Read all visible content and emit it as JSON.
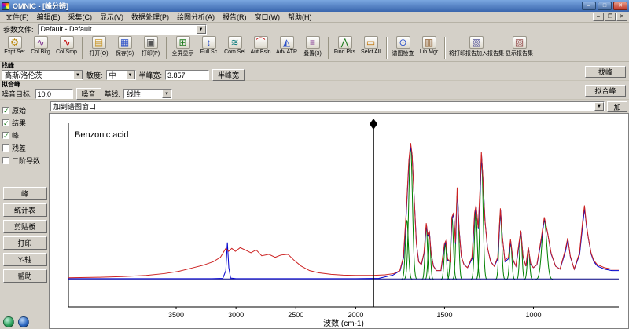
{
  "window": {
    "title": "OMNIC - [峰分辨]",
    "controls": {
      "minimize": "–",
      "maximize": "□",
      "restore": "❐",
      "close": "✕"
    }
  },
  "menu": {
    "items": [
      {
        "label": "文件(F)",
        "name": "menu-file"
      },
      {
        "label": "编辑(E)",
        "name": "menu-edit"
      },
      {
        "label": "采集(C)",
        "name": "menu-collect"
      },
      {
        "label": "显示(V)",
        "name": "menu-view"
      },
      {
        "label": "数据处理(P)",
        "name": "menu-process"
      },
      {
        "label": "绘图分析(A)",
        "name": "menu-analyze"
      },
      {
        "label": "报告(R)",
        "name": "menu-report"
      },
      {
        "label": "窗口(W)",
        "name": "menu-window"
      },
      {
        "label": "帮助(H)",
        "name": "menu-help"
      }
    ]
  },
  "param_bar": {
    "label": "参数文件:",
    "value": "Default - Default"
  },
  "toolbar": {
    "items": [
      {
        "label": "Expt Set",
        "name": "experiment-setup-button",
        "icon": "experiment-setup-icon",
        "glyph": "⚙",
        "color": "#b8860b"
      },
      {
        "label": "Col Bkg",
        "name": "collect-background-button",
        "icon": "collect-background-icon",
        "glyph": "∿",
        "color": "#7b2d8b"
      },
      {
        "label": "Col Smp",
        "name": "collect-sample-button",
        "icon": "collect-sample-icon",
        "glyph": "∿",
        "color": "#c00000",
        "sep": true
      },
      {
        "label": "打开(O)",
        "name": "open-button",
        "icon": "open-folder-icon",
        "glyph": "▤",
        "color": "#c8972a"
      },
      {
        "label": "保存(S)",
        "name": "save-button",
        "icon": "save-icon",
        "glyph": "▦",
        "color": "#2a4fc8"
      },
      {
        "label": "打印(P)",
        "name": "print-button",
        "icon": "printer-icon",
        "glyph": "▣",
        "color": "#555555",
        "sep": true
      },
      {
        "label": "全屏显示",
        "name": "full-screen-display-button",
        "icon": "full-screen-icon",
        "glyph": "⊞",
        "color": "#1d7a1d"
      },
      {
        "label": "Full Sc",
        "name": "full-scale-button",
        "icon": "full-scale-icon",
        "glyph": "↕",
        "color": "#2a4fc8"
      },
      {
        "label": "Com Sel",
        "name": "common-scale-button",
        "icon": "common-scale-icon",
        "glyph": "≋",
        "color": "#0c7b7b"
      },
      {
        "label": "Aut Bsln",
        "name": "auto-baseline-button",
        "icon": "auto-baseline-icon",
        "glyph": "⌒",
        "color": "#c00000"
      },
      {
        "label": "Adv ATR",
        "name": "advanced-atr-button",
        "icon": "advanced-atr-icon",
        "glyph": "◭",
        "color": "#2a4fc8"
      },
      {
        "label": "叠置(3)",
        "name": "stack-spectra-button",
        "icon": "stacked-spectra-icon",
        "glyph": "≡",
        "color": "#7b2d8b",
        "sep": true
      },
      {
        "label": "Find Pks",
        "name": "find-peaks-button",
        "icon": "find-peaks-icon",
        "glyph": "⋀",
        "color": "#1d7a1d"
      },
      {
        "label": "Selct All",
        "name": "select-all-button",
        "icon": "select-all-icon",
        "glyph": "▭",
        "color": "#c07000",
        "sep": true
      },
      {
        "label": "谱图检查",
        "name": "spectrum-inspect-button",
        "icon": "spectrum-inspect-icon",
        "glyph": "⊙",
        "color": "#2a4fc8"
      },
      {
        "label": "Lib Mgr",
        "name": "library-manager-button",
        "icon": "library-manager-icon",
        "glyph": "▥",
        "color": "#8b5a2b",
        "sep": true
      },
      {
        "label": "将打印报告加入报告集",
        "name": "add-to-report-button",
        "icon": "add-to-report-icon",
        "glyph": "▧",
        "color": "#555599"
      },
      {
        "label": "显示报告集",
        "name": "view-report-button",
        "icon": "view-report-icon",
        "glyph": "▨",
        "color": "#995555"
      }
    ]
  },
  "find_peaks": {
    "section_label": "找峰",
    "shape_value": "高斯/洛伦茨",
    "sensitivity_label": "敏度:",
    "sensitivity_value": "中",
    "fwhm_label": "半峰宽:",
    "fwhm_value": "3.857",
    "fwhm_button": "半峰宽",
    "action_button": "找峰"
  },
  "fit_peaks": {
    "section_label": "拟合峰",
    "noise_label": "噪音目标:",
    "noise_value": "10.0",
    "noise_button": "噪音",
    "baseline_label": "基线:",
    "baseline_value": "线性",
    "action_button": "拟合峰"
  },
  "sidebar": {
    "checkboxes": [
      {
        "label": "原始",
        "name": "checkbox-original",
        "checked": true
      },
      {
        "label": "结果",
        "name": "checkbox-result",
        "checked": true
      },
      {
        "label": "峰",
        "name": "checkbox-peaks",
        "checked": true
      },
      {
        "label": "残差",
        "name": "checkbox-residual",
        "checked": false
      },
      {
        "label": "二阶导数",
        "name": "checkbox-second-derivative",
        "checked": false
      }
    ],
    "buttons": [
      {
        "label": "峰",
        "name": "peaks-table-button"
      },
      {
        "label": "统计表",
        "name": "statistics-button"
      },
      {
        "label": "剪贴板",
        "name": "clipboard-button"
      },
      {
        "label": "打印",
        "name": "print-result-button"
      },
      {
        "label": "Y-轴",
        "name": "y-axis-button"
      },
      {
        "label": "帮助",
        "name": "help-button"
      }
    ]
  },
  "chart_bar": {
    "target_value": "加到谱图窗口",
    "add_button": "加"
  },
  "chart_data": {
    "type": "line",
    "title": "Benzonic acid",
    "xlabel": "波数 (cm-1)",
    "x_ticks": [
      3500,
      3000,
      2500,
      2000,
      1500,
      1000
    ],
    "x_map": [
      [
        4400,
        0.0
      ],
      [
        2000,
        0.522
      ],
      [
        520,
        1.0
      ]
    ],
    "cursor_wavenumber": 1900,
    "ylim": [
      0,
      1
    ],
    "grid": false,
    "legend": false,
    "series": [
      {
        "key": "baseline",
        "name": "基线(线性)",
        "color": "#000080",
        "points": [
          [
            4400,
            0.004
          ],
          [
            520,
            0.004
          ]
        ]
      },
      {
        "key": "result",
        "name": "结果",
        "color": "#0000cc",
        "points": [
          [
            4400,
            0.006
          ],
          [
            3200,
            0.006
          ],
          [
            3110,
            0.008
          ],
          [
            3085,
            0.06
          ],
          [
            3072,
            0.25
          ],
          [
            3060,
            0.08
          ],
          [
            3045,
            0.01
          ],
          [
            3000,
            0.006
          ],
          [
            2600,
            0.006
          ],
          [
            2200,
            0.006
          ],
          [
            2000,
            0.006
          ],
          [
            1870,
            0.008
          ],
          [
            1790,
            0.03
          ],
          [
            1750,
            0.06
          ],
          [
            1730,
            0.15
          ],
          [
            1715,
            0.45
          ],
          [
            1700,
            0.8
          ],
          [
            1690,
            0.9
          ],
          [
            1682,
            0.83
          ],
          [
            1670,
            0.53
          ],
          [
            1658,
            0.24
          ],
          [
            1645,
            0.12
          ],
          [
            1630,
            0.1
          ],
          [
            1615,
            0.18
          ],
          [
            1602,
            0.37
          ],
          [
            1594,
            0.29
          ],
          [
            1585,
            0.32
          ],
          [
            1575,
            0.17
          ],
          [
            1562,
            0.09
          ],
          [
            1545,
            0.06
          ],
          [
            1520,
            0.06
          ],
          [
            1500,
            0.23
          ],
          [
            1492,
            0.25
          ],
          [
            1482,
            0.13
          ],
          [
            1468,
            0.12
          ],
          [
            1458,
            0.41
          ],
          [
            1448,
            0.44
          ],
          [
            1438,
            0.24
          ],
          [
            1428,
            0.6
          ],
          [
            1418,
            0.34
          ],
          [
            1405,
            0.15
          ],
          [
            1390,
            0.1
          ],
          [
            1370,
            0.08
          ],
          [
            1345,
            0.14
          ],
          [
            1330,
            0.44
          ],
          [
            1322,
            0.49
          ],
          [
            1310,
            0.34
          ],
          [
            1300,
            0.58
          ],
          [
            1292,
            0.84
          ],
          [
            1284,
            0.68
          ],
          [
            1272,
            0.39
          ],
          [
            1258,
            0.21
          ],
          [
            1240,
            0.12
          ],
          [
            1220,
            0.09
          ],
          [
            1200,
            0.14
          ],
          [
            1185,
            0.47
          ],
          [
            1175,
            0.29
          ],
          [
            1160,
            0.12
          ],
          [
            1140,
            0.14
          ],
          [
            1128,
            0.26
          ],
          [
            1115,
            0.13
          ],
          [
            1098,
            0.09
          ],
          [
            1080,
            0.24
          ],
          [
            1070,
            0.32
          ],
          [
            1058,
            0.15
          ],
          [
            1042,
            0.09
          ],
          [
            1028,
            0.21
          ],
          [
            1015,
            0.1
          ],
          [
            1000,
            0.08
          ],
          [
            980,
            0.1
          ],
          [
            955,
            0.27
          ],
          [
            938,
            0.41
          ],
          [
            920,
            0.31
          ],
          [
            900,
            0.17
          ],
          [
            875,
            0.09
          ],
          [
            850,
            0.07
          ],
          [
            820,
            0.19
          ],
          [
            806,
            0.27
          ],
          [
            792,
            0.15
          ],
          [
            770,
            0.07
          ],
          [
            740,
            0.17
          ],
          [
            720,
            0.4
          ],
          [
            712,
            0.48
          ],
          [
            702,
            0.36
          ],
          [
            690,
            0.27
          ],
          [
            675,
            0.17
          ],
          [
            660,
            0.12
          ],
          [
            640,
            0.09
          ],
          [
            600,
            0.07
          ],
          [
            560,
            0.06
          ],
          [
            520,
            0.06
          ]
        ]
      },
      {
        "key": "original",
        "name": "原始",
        "color": "#cc2222",
        "points": [
          [
            4400,
            0.012
          ],
          [
            4150,
            0.015
          ],
          [
            3950,
            0.02
          ],
          [
            3750,
            0.028
          ],
          [
            3600,
            0.04
          ],
          [
            3480,
            0.055
          ],
          [
            3380,
            0.075
          ],
          [
            3280,
            0.095
          ],
          [
            3190,
            0.12
          ],
          [
            3130,
            0.15
          ],
          [
            3085,
            0.21
          ],
          [
            3062,
            0.19
          ],
          [
            3035,
            0.21
          ],
          [
            3005,
            0.19
          ],
          [
            2965,
            0.215
          ],
          [
            2925,
            0.2
          ],
          [
            2875,
            0.18
          ],
          [
            2832,
            0.2
          ],
          [
            2785,
            0.16
          ],
          [
            2725,
            0.17
          ],
          [
            2672,
            0.15
          ],
          [
            2625,
            0.165
          ],
          [
            2565,
            0.17
          ],
          [
            2515,
            0.13
          ],
          [
            2455,
            0.09
          ],
          [
            2385,
            0.06
          ],
          [
            2305,
            0.045
          ],
          [
            2205,
            0.035
          ],
          [
            2105,
            0.03
          ],
          [
            2000,
            0.028
          ],
          [
            1905,
            0.028
          ],
          [
            1835,
            0.032
          ],
          [
            1785,
            0.04
          ],
          [
            1752,
            0.06
          ],
          [
            1732,
            0.15
          ],
          [
            1716,
            0.45
          ],
          [
            1701,
            0.8
          ],
          [
            1691,
            0.92
          ],
          [
            1683,
            0.85
          ],
          [
            1671,
            0.55
          ],
          [
            1659,
            0.25
          ],
          [
            1646,
            0.12
          ],
          [
            1631,
            0.1
          ],
          [
            1616,
            0.18
          ],
          [
            1603,
            0.38
          ],
          [
            1595,
            0.3
          ],
          [
            1586,
            0.33
          ],
          [
            1576,
            0.18
          ],
          [
            1563,
            0.09
          ],
          [
            1546,
            0.06
          ],
          [
            1521,
            0.06
          ],
          [
            1501,
            0.24
          ],
          [
            1493,
            0.26
          ],
          [
            1483,
            0.14
          ],
          [
            1469,
            0.12
          ],
          [
            1459,
            0.42
          ],
          [
            1449,
            0.45
          ],
          [
            1439,
            0.25
          ],
          [
            1429,
            0.62
          ],
          [
            1419,
            0.35
          ],
          [
            1406,
            0.16
          ],
          [
            1391,
            0.1
          ],
          [
            1371,
            0.08
          ],
          [
            1346,
            0.15
          ],
          [
            1331,
            0.45
          ],
          [
            1323,
            0.5
          ],
          [
            1311,
            0.35
          ],
          [
            1301,
            0.6
          ],
          [
            1293,
            0.86
          ],
          [
            1285,
            0.7
          ],
          [
            1273,
            0.4
          ],
          [
            1259,
            0.22
          ],
          [
            1241,
            0.12
          ],
          [
            1221,
            0.09
          ],
          [
            1201,
            0.15
          ],
          [
            1186,
            0.48
          ],
          [
            1176,
            0.3
          ],
          [
            1161,
            0.13
          ],
          [
            1141,
            0.15
          ],
          [
            1129,
            0.27
          ],
          [
            1116,
            0.14
          ],
          [
            1099,
            0.09
          ],
          [
            1081,
            0.25
          ],
          [
            1071,
            0.33
          ],
          [
            1059,
            0.16
          ],
          [
            1043,
            0.09
          ],
          [
            1029,
            0.22
          ],
          [
            1016,
            0.11
          ],
          [
            1001,
            0.08
          ],
          [
            981,
            0.1
          ],
          [
            956,
            0.28
          ],
          [
            939,
            0.42
          ],
          [
            921,
            0.32
          ],
          [
            901,
            0.18
          ],
          [
            876,
            0.09
          ],
          [
            851,
            0.07
          ],
          [
            821,
            0.2
          ],
          [
            807,
            0.28
          ],
          [
            793,
            0.16
          ],
          [
            771,
            0.07
          ],
          [
            741,
            0.18
          ],
          [
            721,
            0.42
          ],
          [
            713,
            0.5
          ],
          [
            703,
            0.38
          ],
          [
            691,
            0.28
          ],
          [
            676,
            0.18
          ],
          [
            661,
            0.13
          ],
          [
            641,
            0.1
          ],
          [
            601,
            0.08
          ],
          [
            561,
            0.07
          ],
          [
            520,
            0.07
          ]
        ]
      }
    ],
    "green_peaks": {
      "color": "#008000",
      "peaks": [
        [
          1691,
          0.9,
          12
        ],
        [
          1712,
          0.4,
          10
        ],
        [
          1603,
          0.36,
          8
        ],
        [
          1586,
          0.31,
          8
        ],
        [
          1496,
          0.24,
          8
        ],
        [
          1458,
          0.42,
          9
        ],
        [
          1428,
          0.58,
          9
        ],
        [
          1324,
          0.46,
          9
        ],
        [
          1292,
          0.82,
          10
        ],
        [
          1186,
          0.45,
          9
        ],
        [
          1128,
          0.25,
          8
        ],
        [
          1071,
          0.31,
          8
        ],
        [
          1028,
          0.2,
          8
        ],
        [
          939,
          0.4,
          16
        ]
      ]
    }
  },
  "corner_icons": [
    {
      "name": "app-icon-green",
      "class": "green"
    },
    {
      "name": "app-icon-blue",
      "class": "blue"
    }
  ]
}
